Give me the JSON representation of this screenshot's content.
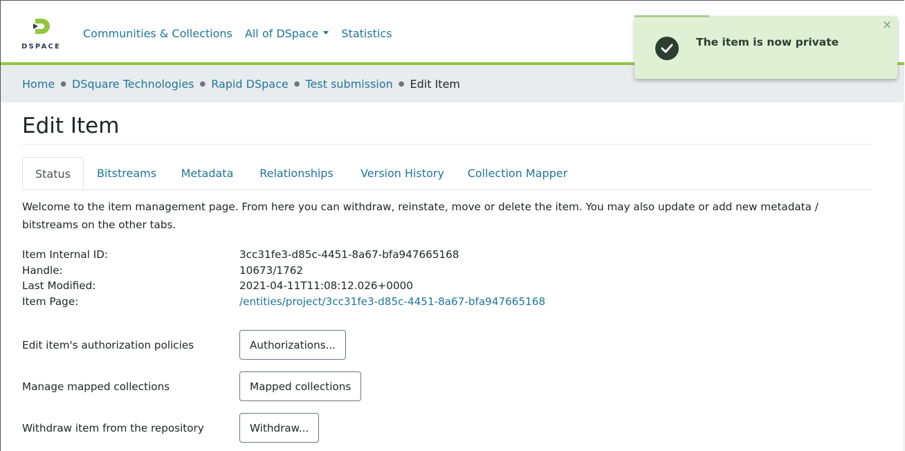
{
  "header": {
    "logo_text": "DSPACE",
    "nav": [
      {
        "label": "Communities & Collections"
      },
      {
        "label": "All of DSpace"
      },
      {
        "label": "Statistics"
      }
    ]
  },
  "breadcrumb": {
    "items": [
      "Home",
      "DSquare Technologies",
      "Rapid DSpace",
      "Test submission"
    ],
    "current": "Edit Item"
  },
  "page": {
    "title": "Edit Item"
  },
  "tabs": [
    {
      "label": "Status",
      "active": true
    },
    {
      "label": "Bitstreams"
    },
    {
      "label": "Metadata"
    },
    {
      "label": "Relationships"
    },
    {
      "label": "Version History"
    },
    {
      "label": "Collection Mapper"
    }
  ],
  "status": {
    "welcome": "Welcome to the item management page. From here you can withdraw, reinstate, move or delete the item. You may also update or add new metadata / bitstreams on the other tabs.",
    "info": [
      {
        "label": "Item Internal ID:",
        "value": "3cc31fe3-d85c-4451-8a67-bfa947665168"
      },
      {
        "label": "Handle:",
        "value": "10673/1762"
      },
      {
        "label": "Last Modified:",
        "value": "2021-04-11T11:08:12.026+0000"
      },
      {
        "label": "Item Page:",
        "value": "/entities/project/3cc31fe3-d85c-4451-8a67-bfa947665168"
      }
    ],
    "actions": [
      {
        "label": "Edit item's authorization policies",
        "button": "Authorizations..."
      },
      {
        "label": "Manage mapped collections",
        "button": "Mapped collections"
      },
      {
        "label": "Withdraw item from the repository",
        "button": "Withdraw..."
      }
    ]
  },
  "toast": {
    "message": "The item is now private",
    "close": "×"
  },
  "colors": {
    "link": "#207698",
    "accent_green": "#92c642",
    "toast_bg": "#dff0d4",
    "breadcrumb_bg": "#e9ecef"
  }
}
